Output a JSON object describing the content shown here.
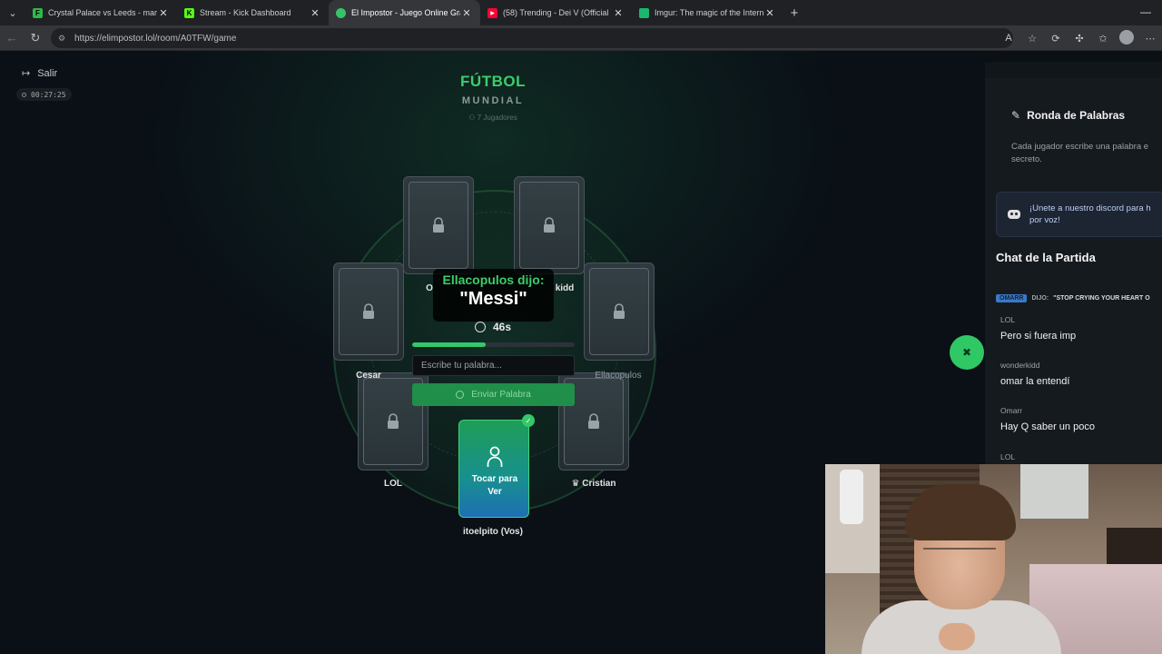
{
  "browser": {
    "tabs": [
      {
        "title": "Crystal Palace vs Leeds - marcador",
        "color": "#2fb84a",
        "glyph": "F",
        "active": false
      },
      {
        "title": "Stream - Kick Dashboard",
        "color": "#53fc18",
        "glyph": "K",
        "active": false
      },
      {
        "title": "El Impostor - Juego Online Gratis",
        "color": "#35c467",
        "glyph": "",
        "active": true
      },
      {
        "title": "(58) Trending - Dei V (Official",
        "color": "#ff0033",
        "glyph": "▶",
        "active": false
      },
      {
        "title": "Imgur: The magic of the Internet",
        "color": "#1bb76e",
        "glyph": "",
        "active": false
      }
    ],
    "url": "https://elimpostor.lol/room/A0TFW/game"
  },
  "header": {
    "exit_label": "Salir",
    "elapsed": "00:27:25",
    "category_title": "FÚTBOL",
    "category_subtitle": "MUNDIAL",
    "players_count": "7 Jugadores"
  },
  "players": [
    {
      "name": "O",
      "dim": false
    },
    {
      "name": "kidd",
      "dim": false
    },
    {
      "name": "Cesar",
      "dim": false
    },
    {
      "name": "Ellacopulos",
      "dim": true
    },
    {
      "name": "LOL",
      "dim": false
    },
    {
      "name": "♛ Cristian",
      "dim": false
    }
  ],
  "round": {
    "speaker_line": "Ellacopulos dijo:",
    "word": "\"Messi\"",
    "time_left": "46s",
    "time_fraction": 0.45,
    "input_placeholder": "Escribe tu palabra...",
    "send_label": "Enviar Palabra"
  },
  "me": {
    "card_text": "Tocar para Ver",
    "name": "itoelpito (Vos)"
  },
  "side_panel": {
    "round_title": "Ronda de Palabras",
    "round_desc_line1": "Cada jugador escribe una palabra e",
    "round_desc_line2": "secreto.",
    "discord_line1": "¡Unete a nuestro discord para h",
    "discord_line2": "por voz!",
    "chat_title": "Chat de la Partida",
    "system_message": {
      "who": "OMARR",
      "verb": "DIJO:",
      "text": "\"STOP CRYING YOUR HEART O"
    },
    "messages": [
      {
        "name": "LOL",
        "text": "Pero si fuera imp"
      },
      {
        "name": "wonderkidd",
        "text": "omar la entendí"
      },
      {
        "name": "Omarr",
        "text": "Hay Q saber un poco"
      },
      {
        "name": "LOL",
        "text": ""
      }
    ]
  }
}
